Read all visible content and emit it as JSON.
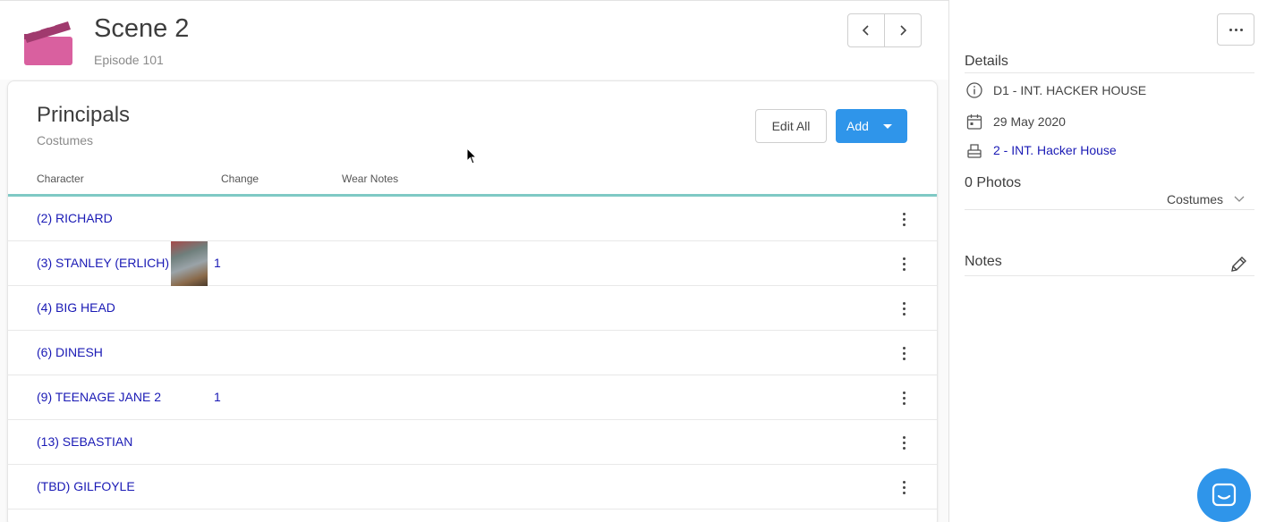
{
  "scene": {
    "title": "Scene 2",
    "episode": "Episode 101"
  },
  "card": {
    "title": "Principals",
    "subtitle": "Costumes",
    "edit_all_label": "Edit All",
    "add_label": "Add",
    "columns": [
      "Character",
      "Change",
      "Wear Notes"
    ]
  },
  "rows": [
    {
      "character": "(2) RICHARD",
      "change": "",
      "has_photo": false
    },
    {
      "character": "(3) STANLEY (ERLICH)",
      "change": "1",
      "has_photo": true
    },
    {
      "character": "(4) BIG HEAD",
      "change": "",
      "has_photo": false
    },
    {
      "character": "(6) DINESH",
      "change": "",
      "has_photo": false
    },
    {
      "character": "(9) TEENAGE JANE 2",
      "change": "1",
      "has_photo": false
    },
    {
      "character": "(13) SEBASTIAN",
      "change": "",
      "has_photo": false
    },
    {
      "character": "(TBD) GILFOYLE",
      "change": "",
      "has_photo": false
    }
  ],
  "details": {
    "title": "Details",
    "set": "D1 - INT. HACKER HOUSE",
    "date": "29 May 2020",
    "location_link": "2 - INT. Hacker House"
  },
  "photos": {
    "title": "0 Photos",
    "filter": "Costumes"
  },
  "notes": {
    "title": "Notes"
  },
  "colors": {
    "accent_blue": "#2f95ea",
    "link_blue": "#1a1ab5",
    "clapper_pink": "#d9609f",
    "clapper_dark": "#a03a6e",
    "teal_divider": "#7fc9c5"
  },
  "icons": {
    "prev": "chevron-left-icon",
    "next": "chevron-right-icon",
    "more": "more-horizontal-icon",
    "info": "info-icon",
    "calendar": "calendar-icon",
    "location": "location-icon",
    "pencil": "pencil-icon",
    "chat": "chat-icon"
  }
}
